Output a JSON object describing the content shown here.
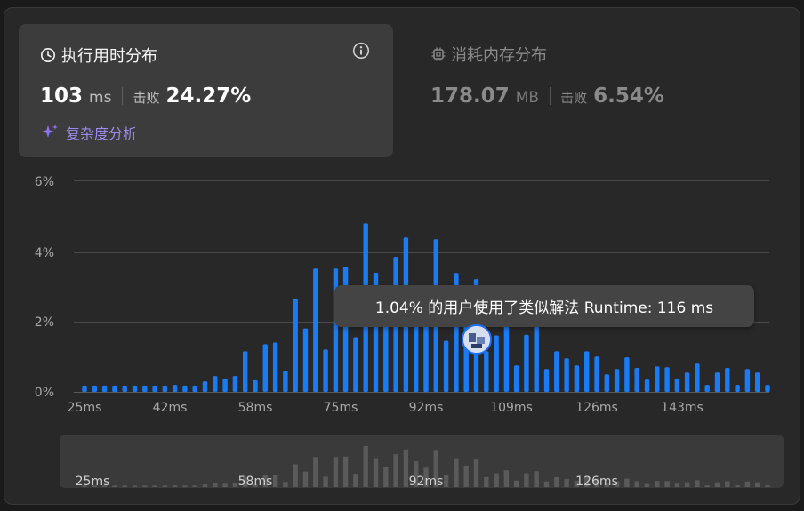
{
  "runtime": {
    "title": "执行用时分布",
    "value": "103",
    "unit": "ms",
    "beat_label": "击败",
    "beat_value": "24.27%",
    "complexity_label": "复杂度分析"
  },
  "memory": {
    "title": "消耗内存分布",
    "value": "178.07",
    "unit": "MB",
    "beat_label": "击败",
    "beat_value": "6.54%"
  },
  "tooltip": {
    "text": "1.04% 的用户使用了类似解法 Runtime: 116 ms"
  },
  "colors": {
    "bar": "#1a7cf5",
    "brush_bar": "#5a5a5a",
    "accent": "#9c8bea"
  },
  "chart_data": {
    "type": "bar",
    "x": [
      25,
      27,
      29,
      31,
      33,
      35,
      37,
      39,
      41,
      43,
      45,
      47,
      49,
      51,
      53,
      55,
      57,
      59,
      61,
      63,
      65,
      67,
      69,
      71,
      73,
      75,
      77,
      79,
      81,
      83,
      85,
      87,
      89,
      91,
      93,
      95,
      97,
      99,
      101,
      103,
      105,
      107,
      109,
      111,
      113,
      115,
      117,
      119,
      121,
      123,
      125,
      127,
      129,
      131,
      133,
      135,
      137,
      139,
      141,
      143,
      145,
      147,
      149,
      151,
      153,
      155,
      157,
      159,
      161
    ],
    "values": [
      0.18,
      0.18,
      0.18,
      0.18,
      0.18,
      0.18,
      0.18,
      0.18,
      0.18,
      0.2,
      0.18,
      0.18,
      0.3,
      0.45,
      0.38,
      0.45,
      1.15,
      0.33,
      1.35,
      1.4,
      0.6,
      2.65,
      1.8,
      3.5,
      1.2,
      3.5,
      3.55,
      1.55,
      4.78,
      3.38,
      2.35,
      3.83,
      4.38,
      3.0,
      2.25,
      4.33,
      1.45,
      3.37,
      2.5,
      3.2,
      1.15,
      1.6,
      1.95,
      0.75,
      1.62,
      1.85,
      0.65,
      1.15,
      0.95,
      0.75,
      1.15,
      1.0,
      0.5,
      0.65,
      0.98,
      0.68,
      0.35,
      0.72,
      0.7,
      0.38,
      0.55,
      0.8,
      0.2,
      0.55,
      0.68,
      0.2,
      0.65,
      0.55,
      0.2
    ],
    "xticks": [
      "25ms",
      "42ms",
      "58ms",
      "75ms",
      "92ms",
      "109ms",
      "126ms",
      "143ms"
    ],
    "yticks": [
      "0%",
      "2%",
      "4%",
      "6%"
    ],
    "ylim": [
      0,
      6
    ],
    "brush_ticks": [
      "25ms",
      "58ms",
      "92ms",
      "126ms"
    ],
    "highlight": {
      "x": 116,
      "value": 1.04
    }
  }
}
